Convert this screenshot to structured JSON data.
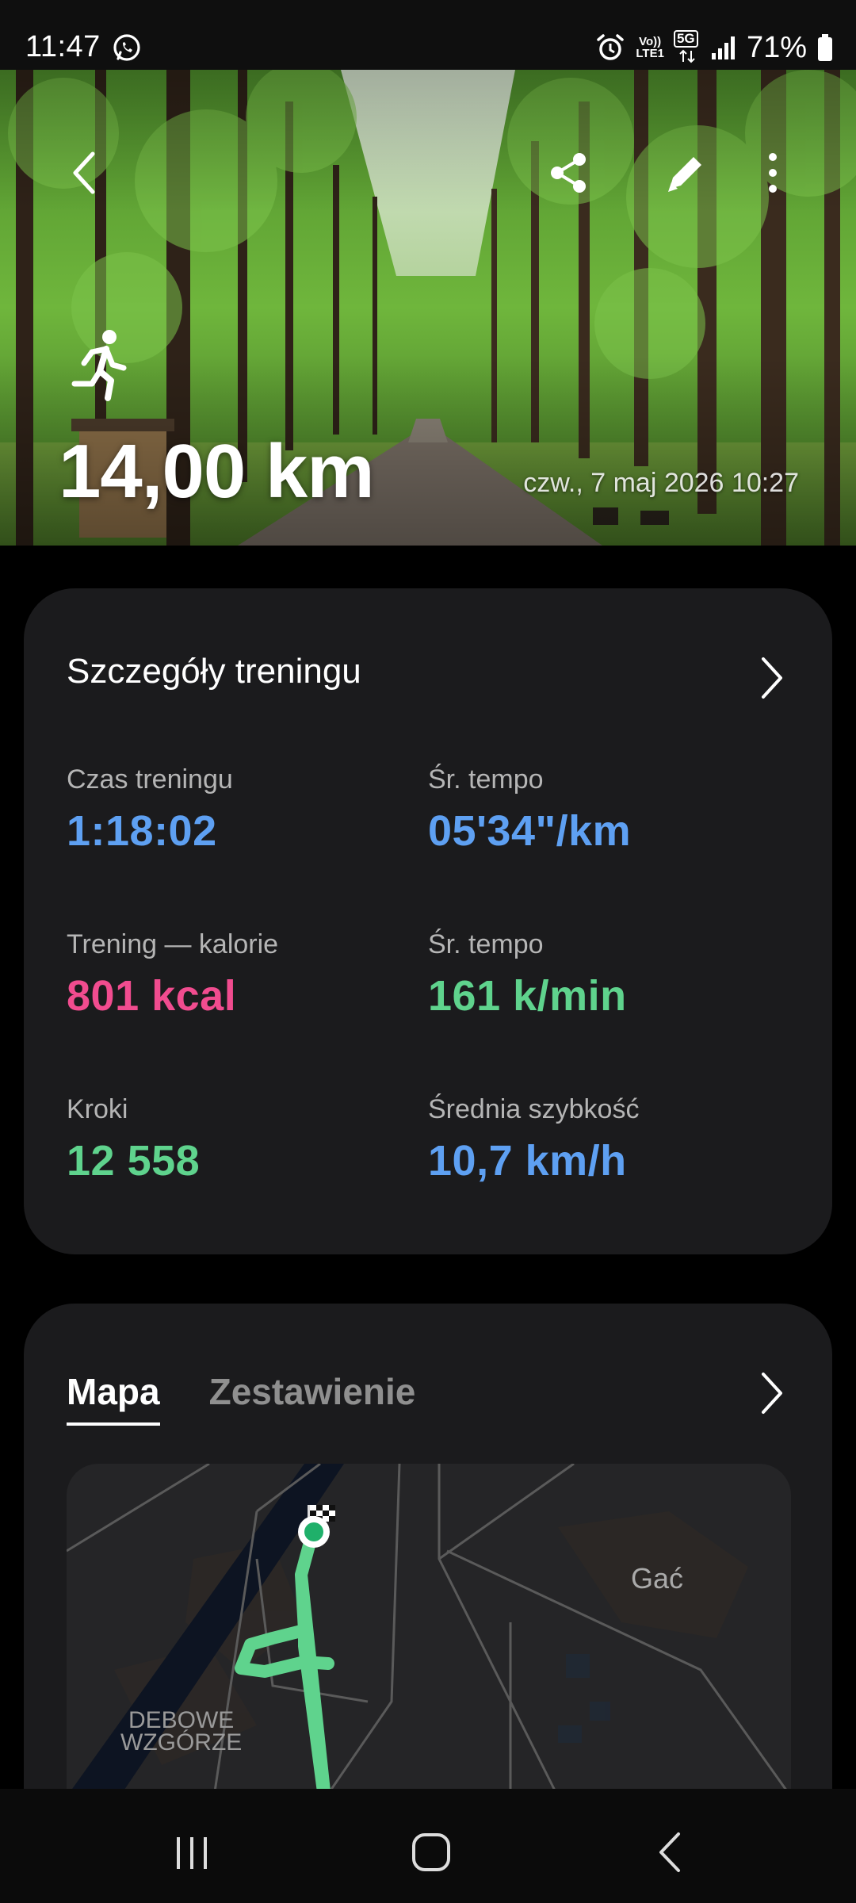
{
  "status_bar": {
    "time": "11:47",
    "app_icon": "whatsapp-icon",
    "alarm_icon": "alarm-icon",
    "volte_top": "Vo))",
    "volte_bottom": "LTE1",
    "network": "5G",
    "battery_percent": "71%"
  },
  "hero": {
    "activity_icon": "running-person-icon",
    "distance": "14,00 km",
    "datetime": "czw., 7 maj 2026 10:27",
    "actions": [
      "back-icon",
      "share-icon",
      "edit-icon",
      "more-icon"
    ]
  },
  "details": {
    "title": "Szczegóły treningu",
    "stats": [
      {
        "label": "Czas treningu",
        "value": "1:18:02",
        "color": "#5ea0f2"
      },
      {
        "label": "Śr. tempo",
        "value": "05'34\"/km",
        "color": "#5ea0f2"
      },
      {
        "label": "Trening — kalorie",
        "value": "801 kcal",
        "color": "#f14c8f"
      },
      {
        "label": "Śr. tempo",
        "value": "161 k/min",
        "color": "#5fd38d"
      },
      {
        "label": "Kroki",
        "value": "12 558",
        "color": "#5fd38d"
      },
      {
        "label": "Średnia szybkość",
        "value": "10,7 km/h",
        "color": "#5ea0f2"
      }
    ]
  },
  "map_section": {
    "tabs": [
      {
        "label": "Mapa",
        "active": true
      },
      {
        "label": "Zestawienie",
        "active": false
      }
    ],
    "place_gac": "Gać",
    "place_debowe_1": "DEBOWE",
    "place_debowe_2": "WZGÓRZE",
    "route_color": "#5fd38d"
  },
  "nav_bar": {
    "items": [
      "recents-icon",
      "home-icon",
      "back-icon"
    ]
  }
}
